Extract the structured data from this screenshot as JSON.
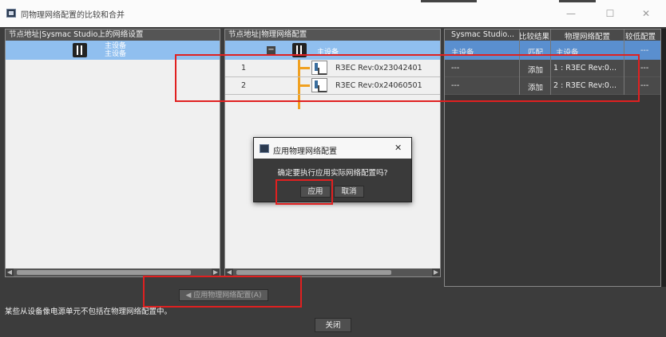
{
  "window": {
    "title": "同物理网络配置的比较和合并",
    "minimize_glyph": "—",
    "maximize_glyph": "☐",
    "close_glyph": "✕"
  },
  "left_panel": {
    "header": "节点地址|Sysmac Studio上的网络设置",
    "root_device": {
      "line1": "主设备",
      "line2": "主设备"
    }
  },
  "middle_panel": {
    "header": "节点地址|物理网络配置",
    "root_device": "主设备",
    "collapse_glyph": "−",
    "rows": [
      {
        "node": "1",
        "device": "R3EC Rev:0x23042401"
      },
      {
        "node": "2",
        "device": "R3EC Rev:0x24060501"
      }
    ]
  },
  "right_panel": {
    "headers": [
      "Sysmac Studio...",
      "比较结果",
      "物理网络配置",
      "较低配置"
    ],
    "rows": [
      {
        "sysmac": "主设备",
        "result": "匹配",
        "physical": "主设备",
        "lower": "---"
      },
      {
        "sysmac": "---",
        "result": "添加",
        "physical": "1 : R3EC Rev:0...",
        "lower": "---"
      },
      {
        "sysmac": "---",
        "result": "添加",
        "physical": "2 : R3EC Rev:0...",
        "lower": "---"
      }
    ]
  },
  "apply_button_label": "◀ 应用物理网络配置(A)",
  "status_message": "某些从设备像电源单元不包括在物理网络配置中。",
  "close_button_label": "关闭",
  "dialog": {
    "title": "应用物理网络配置",
    "close_glyph": "✕",
    "message": "确定要执行应用实际网络配置吗?",
    "apply_label": "应用",
    "cancel_label": "取消"
  },
  "colors": {
    "accent_selection": "#90bfef",
    "annotation_red": "#e02020",
    "connector_orange": "#f0a020"
  }
}
